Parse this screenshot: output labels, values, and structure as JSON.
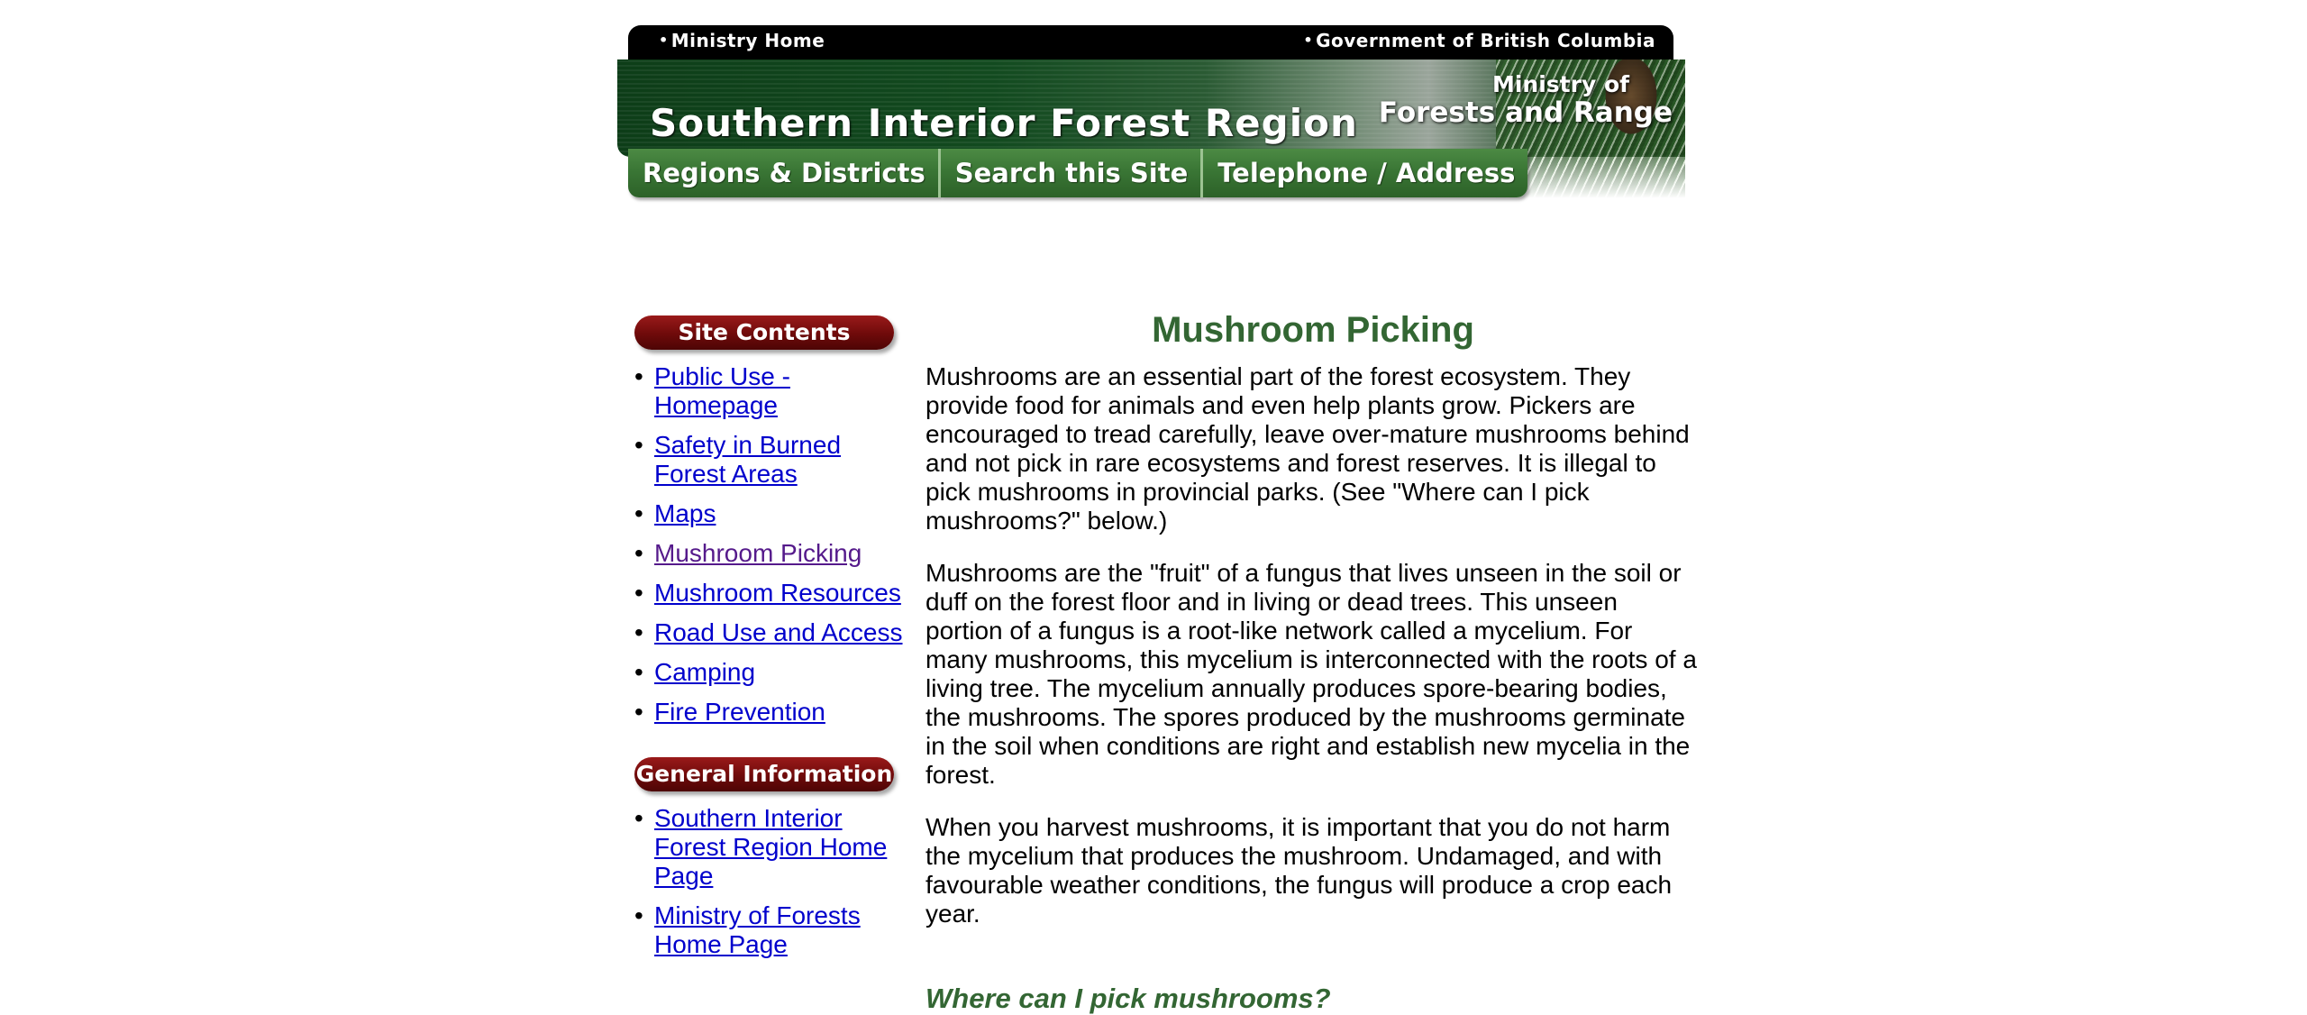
{
  "header": {
    "top_left_link": "Ministry Home",
    "top_right_link": "Government of British Columbia",
    "title": "Southern Interior Forest Region",
    "ministry_line1": "Ministry of",
    "ministry_line2": "Forests and Range",
    "nav": [
      {
        "label": "Regions & Districts"
      },
      {
        "label": "Search this Site"
      },
      {
        "label": "Telephone / Address"
      }
    ]
  },
  "sidebar": {
    "site_contents_label": "Site Contents",
    "site_contents": [
      {
        "label": "Public Use - Homepage"
      },
      {
        "label": "Safety in Burned Forest Areas"
      },
      {
        "label": "Maps"
      },
      {
        "label": "Mushroom Picking"
      },
      {
        "label": "Mushroom Resources"
      },
      {
        "label": "Road Use and Access"
      },
      {
        "label": "Camping"
      },
      {
        "label": "Fire Prevention"
      }
    ],
    "general_info_label": "General Information",
    "general_info": [
      {
        "label": "Southern Interior Forest Region Home Page"
      },
      {
        "label": "Ministry of Forests Home Page"
      }
    ]
  },
  "main": {
    "title": "Mushroom Picking",
    "paragraphs": [
      "Mushrooms are an essential part of the forest ecosystem. They provide food for animals and even help plants grow. Pickers are encouraged to tread carefully, leave over-mature mushrooms behind and not pick in rare ecosystems and forest reserves. It is illegal to pick mushrooms in provincial parks. (See \"Where can I pick mushrooms?\" below.)",
      "Mushrooms are the \"fruit\" of a fungus that lives unseen in the soil or duff on the forest floor and in living or dead trees. This unseen portion of a fungus is a root-like network called a mycelium. For many mushrooms, this mycelium is interconnected with the roots of a living tree. The mycelium annually produces spore-bearing bodies, the mushrooms. The spores produced by the mushrooms germinate in the soil when conditions are right and establish new mycelia in the forest.",
      "When you harvest mushrooms, it is important that you do not harm the mycelium that produces the mushroom. Undamaged, and with favourable weather conditions, the fungus will produce a crop each year."
    ],
    "subheading": "Where can I pick mushrooms?"
  },
  "colors": {
    "heading_green": "#336633",
    "link_blue": "#0000cc",
    "visited_purple": "#551a8b",
    "sidebar_header_red": "#6e0a0a",
    "nav_green": "#3a7635"
  }
}
